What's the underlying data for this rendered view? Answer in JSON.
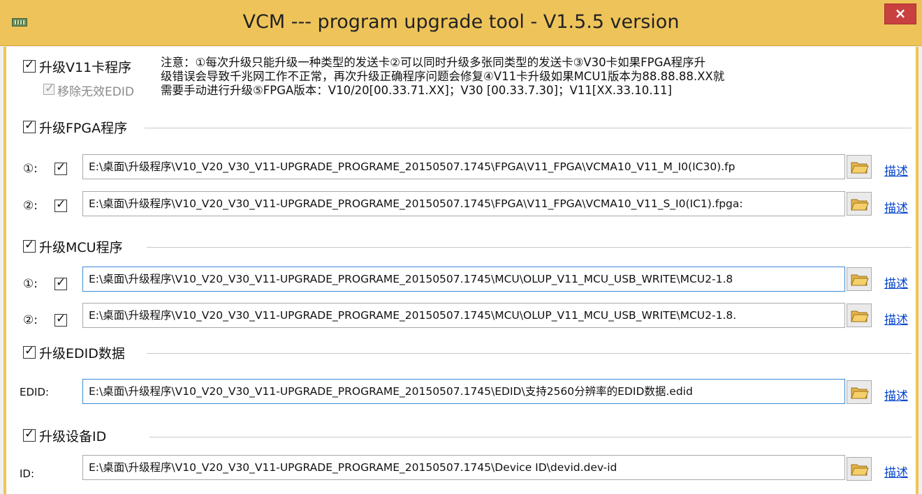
{
  "window": {
    "title": "VCM --- program upgrade tool - V1.5.5 version",
    "close_label": "×"
  },
  "v11": {
    "label": "升级V11卡程序",
    "remove_edid_label": "移除无效EDID"
  },
  "notice": {
    "line1": "注意：①每次升级只能升级一种类型的发送卡②可以同时升级多张同类型的发送卡③V30卡如果FPGA程序升",
    "line2": "级错误会导致千兆网工作不正常，再次升级正确程序问题会修复④V11卡升级如果MCU1版本为88.88.88.XX就",
    "line3": "需要手动进行升级⑤FPGA版本：V10/20[00.33.71.XX]；V30 [00.33.7.30]；V11[XX.33.10.11]"
  },
  "fpga": {
    "label": "升级FPGA程序",
    "row1_label": "①:",
    "row1_path": "E:\\桌面\\升级程序\\V10_V20_V30_V11-UPGRADE_PROGRAME_20150507.1745\\FPGA\\V11_FPGA\\VCMA10_V11_M_I0(IC30).fp",
    "row2_label": "②:",
    "row2_path": "E:\\桌面\\升级程序\\V10_V20_V30_V11-UPGRADE_PROGRAME_20150507.1745\\FPGA\\V11_FPGA\\VCMA10_V11_S_I0(IC1).fpga:"
  },
  "mcu": {
    "label": "升级MCU程序",
    "row1_label": "①:",
    "row1_path": "E:\\桌面\\升级程序\\V10_V20_V30_V11-UPGRADE_PROGRAME_20150507.1745\\MCU\\OLUP_V11_MCU_USB_WRITE\\MCU2-1.8",
    "row2_label": "②:",
    "row2_path": "E:\\桌面\\升级程序\\V10_V20_V30_V11-UPGRADE_PROGRAME_20150507.1745\\MCU\\OLUP_V11_MCU_USB_WRITE\\MCU2-1.8."
  },
  "edid": {
    "label": "升级EDID数据",
    "row_label": "EDID:",
    "path": "E:\\桌面\\升级程序\\V10_V20_V30_V11-UPGRADE_PROGRAME_20150507.1745\\EDID\\支持2560分辨率的EDID数据.edid"
  },
  "device_id": {
    "label": "升级设备ID",
    "row_label": "ID:",
    "path": "E:\\桌面\\升级程序\\V10_V20_V30_V11-UPGRADE_PROGRAME_20150507.1745\\Device ID\\devid.dev-id"
  },
  "desc_label": "描述",
  "colors": {
    "titlebar": "#eec45a",
    "close": "#c94040",
    "link": "#0645cc",
    "focus_border": "#3c8bd9"
  }
}
